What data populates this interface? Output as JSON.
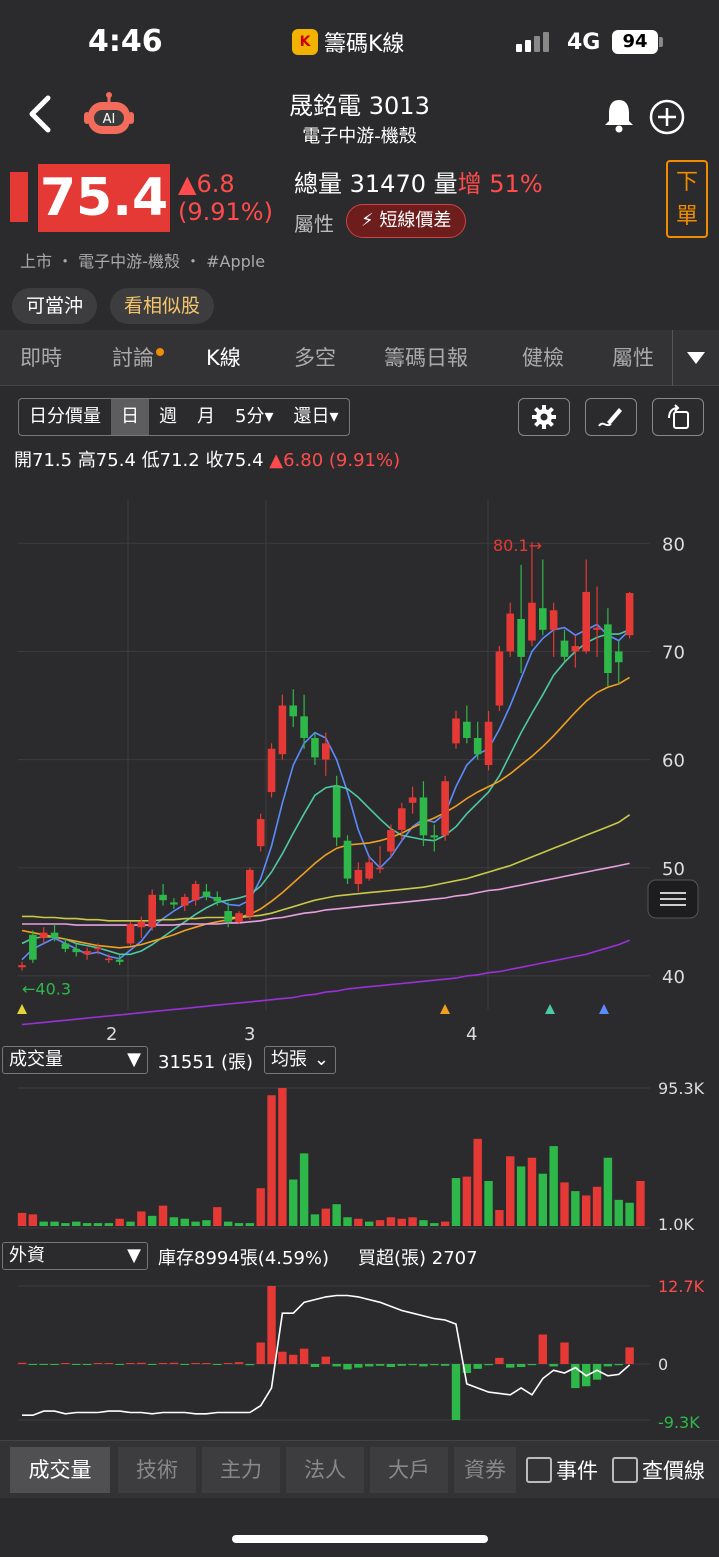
{
  "status": {
    "time": "4:46",
    "app": "籌碼K線",
    "network": "4G",
    "battery": "94"
  },
  "header": {
    "title": "晟銘電 3013",
    "subtitle": "電子中游-機殼",
    "ai": "AI"
  },
  "quote": {
    "price": "75.4",
    "change": "▲6.8",
    "change_pct": "(9.91%)",
    "volume_label": "總量",
    "volume": "31470",
    "vol_unit": "量",
    "vol_inc": "增",
    "vol_inc_pct": "51%",
    "attr_label": "屬性",
    "attr_tag": "短線價差",
    "order": "下單"
  },
  "meta": "上市 ・ 電子中游-機殼 ・ #Apple",
  "chips": [
    "可當沖",
    "看相似股"
  ],
  "tabs": [
    "即時",
    "討論",
    "K線",
    "多空",
    "籌碼日報",
    "健檢",
    "屬性"
  ],
  "periods": [
    "日分價量",
    "日",
    "週",
    "月",
    "5分▾",
    "還日▾"
  ],
  "ohlc": {
    "open": "開71.5",
    "high": "高75.4",
    "low": "低71.2",
    "close": "收75.4",
    "chg": "▲6.80 (9.91%)"
  },
  "chart_data": {
    "type": "candlestick",
    "y_ticks": [
      "80",
      "70",
      "60",
      "50",
      "40"
    ],
    "ylim": [
      35,
      84
    ],
    "x_ticks": [
      "2",
      "3",
      "4"
    ],
    "max_label": "80.1→",
    "min_label": "←40.3",
    "candles": [
      [
        40.8,
        41.3,
        40.5,
        41.0
      ],
      [
        43.8,
        44.2,
        41.2,
        41.5
      ],
      [
        43.5,
        44.5,
        43.0,
        44.0
      ],
      [
        44.0,
        44.8,
        43.2,
        43.5
      ],
      [
        43.0,
        43.5,
        42.2,
        42.5
      ],
      [
        42.5,
        43.0,
        41.8,
        42.2
      ],
      [
        42.0,
        42.6,
        41.5,
        42.3
      ],
      [
        42.6,
        43.0,
        42.0,
        42.6
      ],
      [
        41.5,
        42.0,
        41.2,
        41.6
      ],
      [
        41.5,
        42.0,
        41.0,
        41.3
      ],
      [
        43.0,
        45.0,
        42.8,
        44.8
      ],
      [
        44.5,
        45.5,
        43.5,
        45.0
      ],
      [
        44.5,
        48.0,
        44.2,
        47.5
      ],
      [
        47.5,
        48.5,
        46.5,
        47.0
      ],
      [
        46.8,
        47.2,
        46.2,
        46.6
      ],
      [
        46.5,
        47.6,
        46.0,
        47.3
      ],
      [
        47.0,
        48.8,
        46.5,
        48.5
      ],
      [
        47.8,
        48.5,
        47.0,
        47.3
      ],
      [
        47.3,
        47.8,
        46.5,
        46.9
      ],
      [
        46.0,
        46.8,
        44.5,
        45.0
      ],
      [
        45.0,
        46.0,
        44.8,
        45.8
      ],
      [
        45.5,
        50.0,
        45.2,
        49.8
      ],
      [
        52.0,
        55.0,
        51.5,
        54.5
      ],
      [
        57.0,
        61.5,
        56.5,
        61.0
      ],
      [
        60.5,
        66.0,
        60.0,
        65.0
      ],
      [
        65.0,
        66.5,
        63.0,
        64.0
      ],
      [
        64.0,
        66.0,
        61.0,
        62.0
      ],
      [
        62.0,
        62.5,
        59.5,
        60.2
      ],
      [
        60.0,
        62.5,
        58.5,
        61.5
      ],
      [
        57.5,
        58.5,
        52.0,
        52.8
      ],
      [
        52.5,
        53.0,
        48.5,
        49.0
      ],
      [
        48.5,
        50.5,
        47.8,
        49.8
      ],
      [
        49.0,
        51.0,
        48.8,
        50.5
      ],
      [
        50.0,
        52.0,
        49.5,
        50.0
      ],
      [
        51.5,
        54.0,
        51.0,
        53.5
      ],
      [
        53.5,
        56.0,
        52.5,
        55.5
      ],
      [
        56.0,
        57.5,
        55.0,
        56.5
      ],
      [
        56.5,
        58.0,
        52.0,
        53.0
      ],
      [
        53.0,
        54.0,
        51.5,
        52.8
      ],
      [
        53.0,
        58.5,
        52.5,
        58.0
      ],
      [
        61.5,
        64.5,
        61.0,
        63.8
      ],
      [
        63.5,
        65.0,
        61.5,
        62.0
      ],
      [
        62.0,
        63.5,
        60.0,
        60.5
      ],
      [
        59.5,
        64.5,
        59.0,
        63.5
      ],
      [
        65.0,
        70.5,
        64.5,
        70.0
      ],
      [
        70.0,
        74.5,
        69.5,
        73.5
      ],
      [
        73.0,
        78.0,
        68.0,
        69.5
      ],
      [
        71.0,
        80.1,
        70.5,
        74.5
      ],
      [
        74.0,
        78.5,
        71.5,
        72.0
      ],
      [
        72.0,
        74.5,
        69.5,
        73.8
      ],
      [
        71.0,
        72.0,
        69.0,
        69.5
      ],
      [
        70.0,
        71.5,
        68.5,
        70.5
      ],
      [
        70.0,
        78.5,
        69.8,
        75.5
      ],
      [
        72.0,
        76.0,
        69.5,
        72.2
      ],
      [
        72.5,
        74.0,
        66.8,
        68.0
      ],
      [
        70.0,
        71.0,
        67.0,
        69.0
      ],
      [
        71.5,
        75.5,
        71.2,
        75.4
      ]
    ],
    "ma_lines": [
      {
        "color": "#5b8cff",
        "points": [
          41.5,
          42.5,
          43.0,
          43.5,
          43.0,
          42.5,
          42.0,
          42.2,
          41.8,
          41.6,
          42.4,
          43.2,
          44.5,
          45.3,
          46.0,
          46.6,
          47.1,
          47.4,
          47.1,
          46.6,
          46.5,
          47.0,
          49.0,
          52.0,
          56.0,
          59.5,
          61.5,
          62.5,
          62.0,
          60.0,
          57.0,
          53.5,
          51.0,
          50.0,
          51.0,
          52.5,
          53.8,
          54.5,
          54.2,
          55.0,
          57.5,
          59.5,
          60.5,
          61.0,
          62.8,
          65.0,
          67.5,
          70.0,
          71.2,
          72.0,
          72.2,
          71.5,
          72.0,
          72.5,
          71.5,
          71.0,
          72.0
        ]
      },
      {
        "color": "#4ec9a3",
        "points": [
          43.0,
          43.5,
          43.6,
          43.6,
          43.4,
          43.0,
          42.8,
          42.6,
          42.3,
          42.0,
          42.0,
          42.3,
          42.9,
          43.6,
          44.3,
          45.0,
          45.7,
          46.3,
          46.8,
          47.0,
          47.2,
          47.5,
          48.3,
          49.6,
          51.3,
          53.2,
          55.0,
          56.7,
          57.4,
          57.6,
          57.3,
          56.5,
          55.5,
          54.5,
          53.6,
          53.0,
          52.8,
          52.6,
          52.5,
          53.0,
          53.8,
          55.0,
          56.0,
          57.0,
          58.5,
          60.5,
          62.5,
          64.3,
          66.0,
          67.8,
          69.0,
          70.0,
          70.8,
          71.3,
          71.6,
          71.6,
          72.0
        ]
      },
      {
        "color": "#f0a020",
        "points": [
          44.2,
          44.0,
          43.8,
          43.6,
          43.4,
          43.2,
          43.0,
          42.8,
          42.7,
          42.6,
          42.7,
          42.9,
          43.2,
          43.5,
          43.8,
          44.2,
          44.5,
          44.8,
          45.0,
          45.2,
          45.4,
          45.7,
          46.2,
          46.9,
          47.7,
          48.6,
          49.5,
          50.4,
          51.2,
          51.8,
          52.1,
          52.2,
          52.3,
          52.5,
          52.8,
          53.2,
          53.7,
          54.2,
          54.6,
          55.1,
          55.7,
          56.4,
          57.0,
          57.5,
          58.0,
          58.7,
          59.5,
          60.3,
          61.2,
          62.2,
          63.3,
          64.4,
          65.4,
          66.2,
          66.7,
          67.0,
          67.6
        ]
      },
      {
        "color": "#c8c84a",
        "points": [
          45.5,
          45.5,
          45.4,
          45.4,
          45.3,
          45.3,
          45.2,
          45.2,
          45.1,
          45.1,
          45.1,
          45.1,
          45.1,
          45.2,
          45.2,
          45.3,
          45.3,
          45.4,
          45.4,
          45.4,
          45.4,
          45.5,
          45.6,
          45.8,
          46.1,
          46.4,
          46.7,
          47.0,
          47.2,
          47.4,
          47.5,
          47.6,
          47.7,
          47.8,
          47.9,
          48.0,
          48.1,
          48.2,
          48.4,
          48.6,
          48.8,
          49.0,
          49.3,
          49.6,
          49.9,
          50.2,
          50.6,
          51.0,
          51.4,
          51.8,
          52.2,
          52.6,
          53.0,
          53.4,
          53.8,
          54.2,
          54.9
        ]
      },
      {
        "color": "#e8a0e0",
        "points": [
          44.8,
          44.8,
          44.8,
          44.8,
          44.8,
          44.7,
          44.7,
          44.7,
          44.7,
          44.7,
          44.7,
          44.7,
          44.7,
          44.7,
          44.7,
          44.8,
          44.8,
          44.8,
          44.8,
          44.9,
          44.9,
          45.0,
          45.1,
          45.3,
          45.4,
          45.6,
          45.8,
          45.9,
          46.1,
          46.2,
          46.3,
          46.4,
          46.5,
          46.6,
          46.7,
          46.8,
          46.9,
          47.0,
          47.1,
          47.2,
          47.4,
          47.5,
          47.7,
          47.9,
          48.0,
          48.2,
          48.4,
          48.6,
          48.8,
          49.0,
          49.2,
          49.4,
          49.6,
          49.8,
          50.0,
          50.2,
          50.4
        ]
      },
      {
        "color": "#9b30d9",
        "points": [
          35.5,
          35.6,
          35.7,
          35.8,
          35.9,
          36.0,
          36.1,
          36.2,
          36.3,
          36.4,
          36.5,
          36.6,
          36.7,
          36.8,
          36.9,
          37.0,
          37.1,
          37.2,
          37.3,
          37.4,
          37.5,
          37.6,
          37.7,
          37.8,
          37.9,
          38.0,
          38.2,
          38.3,
          38.5,
          38.6,
          38.8,
          38.9,
          39.0,
          39.1,
          39.2,
          39.3,
          39.4,
          39.5,
          39.6,
          39.7,
          39.8,
          40.0,
          40.1,
          40.3,
          40.4,
          40.6,
          40.8,
          41.0,
          41.2,
          41.4,
          41.6,
          41.8,
          42.0,
          42.3,
          42.6,
          42.9,
          43.3
        ]
      }
    ],
    "volume": {
      "label": "成交量",
      "value": "31551 (張)",
      "avg": "均張",
      "max": "95.3K",
      "min": "1.0K",
      "bars": [
        9,
        8,
        3,
        3,
        2,
        3,
        2,
        2,
        2,
        5,
        3,
        10,
        7,
        14,
        6,
        5,
        3,
        4,
        13,
        3,
        2,
        2,
        26,
        90,
        95,
        32,
        50,
        8,
        12,
        15,
        6,
        5,
        3,
        4,
        6,
        5,
        6,
        4,
        2,
        3,
        33,
        34,
        60,
        31,
        11,
        48,
        41,
        47,
        36,
        55,
        30,
        24,
        21,
        27,
        47,
        18,
        16,
        31
      ],
      "up": [
        1,
        1,
        0,
        0,
        0,
        0,
        0,
        0,
        0,
        1,
        0,
        1,
        0,
        1,
        0,
        0,
        0,
        0,
        1,
        0,
        0,
        0,
        1,
        1,
        1,
        0,
        0,
        0,
        1,
        0,
        0,
        1,
        0,
        1,
        1,
        1,
        1,
        0,
        0,
        1,
        0,
        1,
        1,
        0,
        1,
        1,
        0,
        1,
        0,
        0,
        1,
        0,
        1,
        1,
        0,
        0,
        0,
        1
      ]
    },
    "foreign": {
      "label": "外資",
      "inventory": "庫存8994張(4.59%)",
      "net": "買超(張) 2707",
      "max": "12.7K",
      "zero": "0",
      "min": "-9.3K",
      "bars": [
        0.2,
        -0.1,
        -0.1,
        -0.05,
        0.1,
        -0.1,
        -0.1,
        0.05,
        0.1,
        -0.1,
        0.1,
        0.2,
        -0.1,
        0.1,
        0.2,
        -0.1,
        0.1,
        0.1,
        -0.1,
        0.1,
        0.3,
        -0.2,
        3.5,
        12.7,
        2.0,
        1.5,
        2.5,
        -0.5,
        1.2,
        -0.4,
        -0.9,
        -0.6,
        -0.4,
        -0.3,
        -0.5,
        -0.3,
        -0.2,
        -0.4,
        -0.2,
        -0.3,
        -9.3,
        -1.5,
        -0.8,
        -0.2,
        1.0,
        -0.6,
        -0.5,
        -0.2,
        4.8,
        -0.4,
        3.5,
        -4.0,
        -3.7,
        -2.6,
        -0.4,
        -0.2,
        2.7
      ],
      "inv": [
        0.95,
        0.95,
        0.92,
        0.92,
        0.94,
        0.93,
        0.93,
        0.93,
        0.92,
        0.92,
        0.93,
        0.93,
        0.94,
        0.93,
        0.93,
        0.93,
        0.94,
        0.94,
        0.93,
        0.93,
        0.93,
        0.93,
        0.88,
        0.75,
        0.2,
        0.2,
        0.12,
        0.1,
        0.08,
        0.07,
        0.07,
        0.08,
        0.1,
        0.12,
        0.15,
        0.18,
        0.2,
        0.22,
        0.24,
        0.25,
        0.28,
        0.72,
        0.75,
        0.78,
        0.79,
        0.8,
        0.75,
        0.8,
        0.68,
        0.62,
        0.64,
        0.6,
        0.66,
        0.62,
        0.66,
        0.65,
        0.58
      ]
    }
  },
  "bottom_tabs": [
    "成交量",
    "技術",
    "主力",
    "法人",
    "大戶",
    "資券"
  ],
  "checks": [
    "事件",
    "查價線"
  ]
}
